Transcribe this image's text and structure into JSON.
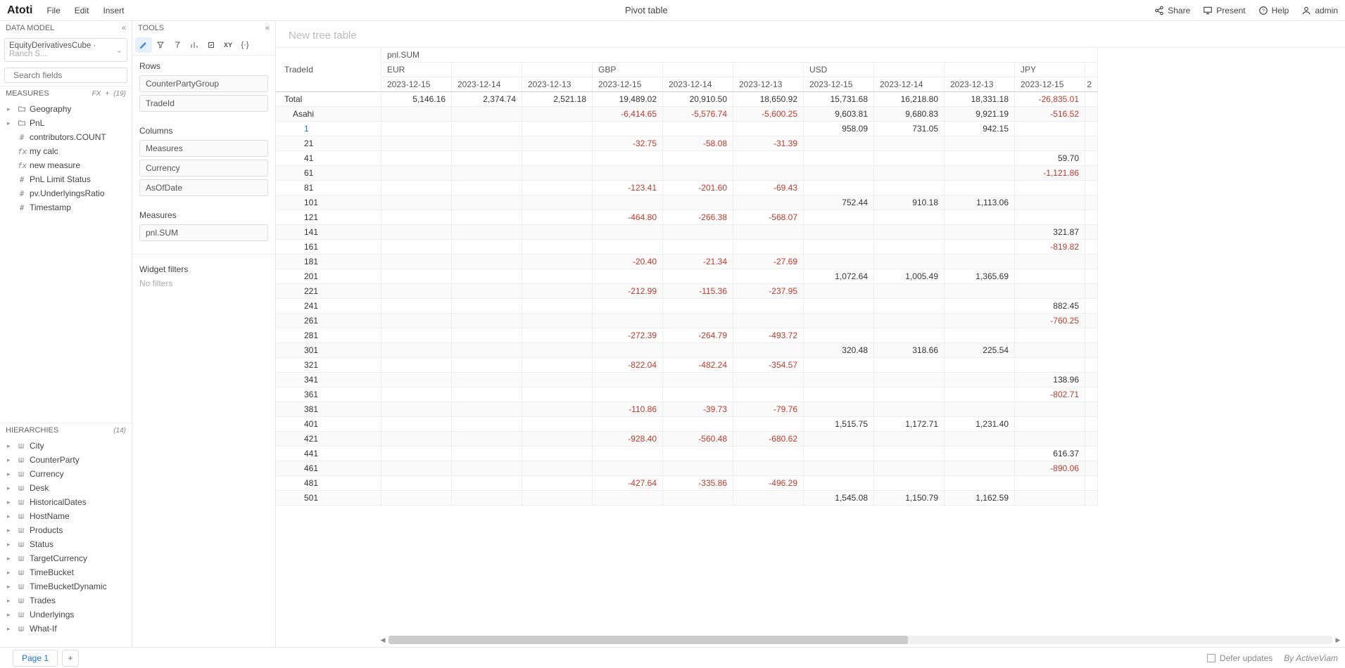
{
  "topbar": {
    "brand": "Atoti",
    "menus": [
      "File",
      "Edit",
      "Insert"
    ],
    "title": "Pivot table",
    "right": {
      "share": "Share",
      "present": "Present",
      "help": "Help",
      "user": "admin"
    }
  },
  "left": {
    "data_model_label": "DATA MODEL",
    "cube": {
      "name": "EquityDerivativesCube",
      "detail": "Ranch S..."
    },
    "search_placeholder": "Search fields",
    "measures": {
      "label": "MEASURES",
      "fx": "fx",
      "plus": "+",
      "count": "(19)",
      "items": [
        {
          "type": "folder",
          "label": "Geography"
        },
        {
          "type": "folder",
          "label": "PnL"
        },
        {
          "type": "hash",
          "label": "contributors.COUNT"
        },
        {
          "type": "fx",
          "label": "my calc"
        },
        {
          "type": "fx",
          "label": "new measure"
        },
        {
          "type": "hash",
          "label": "PnL Limit Status"
        },
        {
          "type": "hash",
          "label": "pv.UnderlyingsRatio"
        },
        {
          "type": "hash",
          "label": "Timestamp"
        }
      ]
    },
    "hierarchies": {
      "label": "HIERARCHIES",
      "count": "(14)",
      "items": [
        "City",
        "CounterParty",
        "Currency",
        "Desk",
        "HistoricalDates",
        "HostName",
        "Products",
        "Status",
        "TargetCurrency",
        "TimeBucket",
        "TimeBucketDynamic",
        "Trades",
        "Underlyings",
        "What-If"
      ]
    }
  },
  "tools": {
    "label": "TOOLS",
    "rows_label": "Rows",
    "rows": [
      "CounterPartyGroup",
      "TradeId"
    ],
    "columns_label": "Columns",
    "columns": [
      "Measures",
      "Currency",
      "AsOfDate"
    ],
    "measures_label": "Measures",
    "measures": [
      "pnl.SUM"
    ],
    "filters_label": "Widget filters",
    "no_filters": "No filters"
  },
  "table": {
    "title_placeholder": "New tree table",
    "row_header": "TradeId",
    "measure_header": "pnl.SUM",
    "currencies": [
      "EUR",
      "GBP",
      "USD",
      "JPY"
    ],
    "dates": [
      "2023-12-15",
      "2023-12-14",
      "2023-12-13"
    ],
    "last_col_frag": "2",
    "total_label": "Total",
    "total_values": [
      "5,146.16",
      "2,374.74",
      "2,521.18",
      "19,489.02",
      "20,910.50",
      "18,650.92",
      "15,731.68",
      "16,218.80",
      "18,331.18",
      "-26,835.01"
    ],
    "group_label": "Asahi",
    "group_values": [
      "",
      "",
      "",
      "-6,414.65",
      "-5,576.74",
      "-5,600.25",
      "9,603.81",
      "9,680.83",
      "9,921.19",
      "-516.52"
    ],
    "rows": [
      {
        "id": "1",
        "link": true,
        "v": [
          "",
          "",
          "",
          "",
          "",
          "",
          "958.09",
          "731.05",
          "942.15",
          ""
        ]
      },
      {
        "id": "21",
        "v": [
          "",
          "",
          "",
          "-32.75",
          "-58.08",
          "-31.39",
          "",
          "",
          "",
          ""
        ]
      },
      {
        "id": "41",
        "v": [
          "",
          "",
          "",
          "",
          "",
          "",
          "",
          "",
          "",
          "59.70"
        ]
      },
      {
        "id": "61",
        "v": [
          "",
          "",
          "",
          "",
          "",
          "",
          "",
          "",
          "",
          "-1,121.86"
        ]
      },
      {
        "id": "81",
        "v": [
          "",
          "",
          "",
          "-123.41",
          "-201.60",
          "-69.43",
          "",
          "",
          "",
          ""
        ]
      },
      {
        "id": "101",
        "v": [
          "",
          "",
          "",
          "",
          "",
          "",
          "752.44",
          "910.18",
          "1,113.06",
          ""
        ]
      },
      {
        "id": "121",
        "v": [
          "",
          "",
          "",
          "-464.80",
          "-266.38",
          "-568.07",
          "",
          "",
          "",
          ""
        ]
      },
      {
        "id": "141",
        "v": [
          "",
          "",
          "",
          "",
          "",
          "",
          "",
          "",
          "",
          "321.87"
        ]
      },
      {
        "id": "161",
        "v": [
          "",
          "",
          "",
          "",
          "",
          "",
          "",
          "",
          "",
          "-819.82"
        ]
      },
      {
        "id": "181",
        "v": [
          "",
          "",
          "",
          "-20.40",
          "-21.34",
          "-27.69",
          "",
          "",
          "",
          ""
        ]
      },
      {
        "id": "201",
        "v": [
          "",
          "",
          "",
          "",
          "",
          "",
          "1,072.64",
          "1,005.49",
          "1,365.69",
          ""
        ]
      },
      {
        "id": "221",
        "v": [
          "",
          "",
          "",
          "-212.99",
          "-115.36",
          "-237.95",
          "",
          "",
          "",
          ""
        ]
      },
      {
        "id": "241",
        "v": [
          "",
          "",
          "",
          "",
          "",
          "",
          "",
          "",
          "",
          "882.45"
        ]
      },
      {
        "id": "261",
        "v": [
          "",
          "",
          "",
          "",
          "",
          "",
          "",
          "",
          "",
          "-760.25"
        ]
      },
      {
        "id": "281",
        "v": [
          "",
          "",
          "",
          "-272.39",
          "-264.79",
          "-493.72",
          "",
          "",
          "",
          ""
        ]
      },
      {
        "id": "301",
        "v": [
          "",
          "",
          "",
          "",
          "",
          "",
          "320.48",
          "318.66",
          "225.54",
          ""
        ]
      },
      {
        "id": "321",
        "v": [
          "",
          "",
          "",
          "-822.04",
          "-482.24",
          "-354.57",
          "",
          "",
          "",
          ""
        ]
      },
      {
        "id": "341",
        "v": [
          "",
          "",
          "",
          "",
          "",
          "",
          "",
          "",
          "",
          "138.96"
        ]
      },
      {
        "id": "361",
        "v": [
          "",
          "",
          "",
          "",
          "",
          "",
          "",
          "",
          "",
          "-802.71"
        ]
      },
      {
        "id": "381",
        "v": [
          "",
          "",
          "",
          "-110.86",
          "-39.73",
          "-79.76",
          "",
          "",
          "",
          ""
        ]
      },
      {
        "id": "401",
        "v": [
          "",
          "",
          "",
          "",
          "",
          "",
          "1,515.75",
          "1,172.71",
          "1,231.40",
          ""
        ]
      },
      {
        "id": "421",
        "v": [
          "",
          "",
          "",
          "-928.40",
          "-560.48",
          "-680.62",
          "",
          "",
          "",
          ""
        ]
      },
      {
        "id": "441",
        "v": [
          "",
          "",
          "",
          "",
          "",
          "",
          "",
          "",
          "",
          "616.37"
        ]
      },
      {
        "id": "461",
        "v": [
          "",
          "",
          "",
          "",
          "",
          "",
          "",
          "",
          "",
          "-890.06"
        ]
      },
      {
        "id": "481",
        "v": [
          "",
          "",
          "",
          "-427.64",
          "-335.86",
          "-496.29",
          "",
          "",
          "",
          ""
        ]
      },
      {
        "id": "501",
        "v": [
          "",
          "",
          "",
          "",
          "",
          "",
          "1,545.08",
          "1,150.79",
          "1,162.59",
          ""
        ]
      }
    ]
  },
  "footer": {
    "page": "Page 1",
    "defer": "Defer updates",
    "by": "By ActiveViam"
  }
}
